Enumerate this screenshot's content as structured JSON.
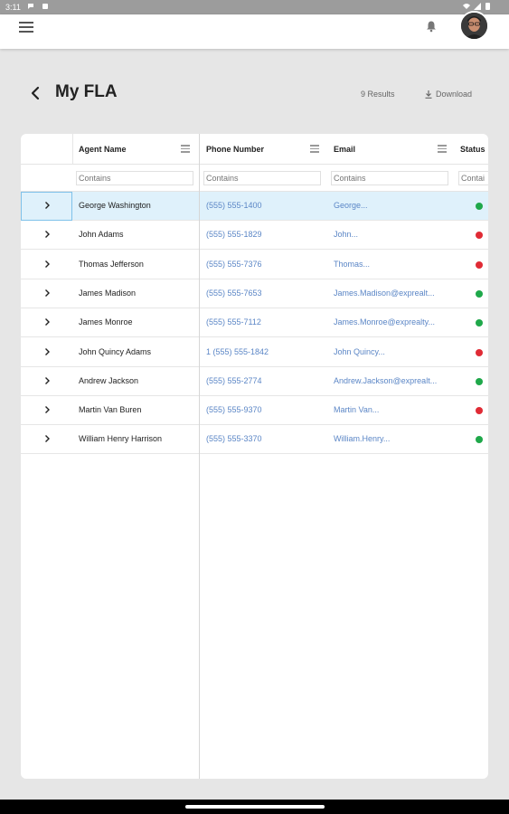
{
  "statusbar": {
    "time": "3:11"
  },
  "page": {
    "title": "My FLA",
    "results": "9 Results",
    "download": "Download"
  },
  "grid": {
    "columns": [
      {
        "label": "Agent Name",
        "filter_placeholder": "Contains"
      },
      {
        "label": "Phone Number",
        "filter_placeholder": "Contains"
      },
      {
        "label": "Email",
        "filter_placeholder": "Contains"
      },
      {
        "label": "Status",
        "filter_placeholder": "Contai"
      }
    ],
    "rows": [
      {
        "name": "George Washington",
        "phone": "(555) 555-1400",
        "email": "George...",
        "status": "active"
      },
      {
        "name": "John Adams",
        "phone": "(555) 555-1829",
        "email": "John...",
        "status": "inactive"
      },
      {
        "name": "Thomas Jefferson",
        "phone": "(555) 555-7376",
        "email": "Thomas...",
        "status": "inactive"
      },
      {
        "name": "James Madison",
        "phone": "(555) 555-7653",
        "email": "James.Madison@exprealt...",
        "status": "active"
      },
      {
        "name": "James Monroe",
        "phone": "(555) 555-7112",
        "email": "James.Monroe@exprealty...",
        "status": "active"
      },
      {
        "name": "John Quincy Adams",
        "phone": "1 (555) 555-1842",
        "email": "John Quincy...",
        "status": "inactive"
      },
      {
        "name": "Andrew Jackson",
        "phone": "(555) 555-2774",
        "email": "Andrew.Jackson@exprealt...",
        "status": "active"
      },
      {
        "name": "Martin Van Buren",
        "phone": "(555) 555-9370",
        "email": "Martin Van...",
        "status": "inactive"
      },
      {
        "name": "William Henry Harrison",
        "phone": "(555) 555-3370",
        "email": "William.Henry...",
        "status": "active"
      }
    ],
    "selected_row": 0
  },
  "colors": {
    "active": "#1fa84a",
    "inactive": "#e02b35",
    "link": "#5b86c6",
    "selected_bg": "#dff1fb"
  }
}
